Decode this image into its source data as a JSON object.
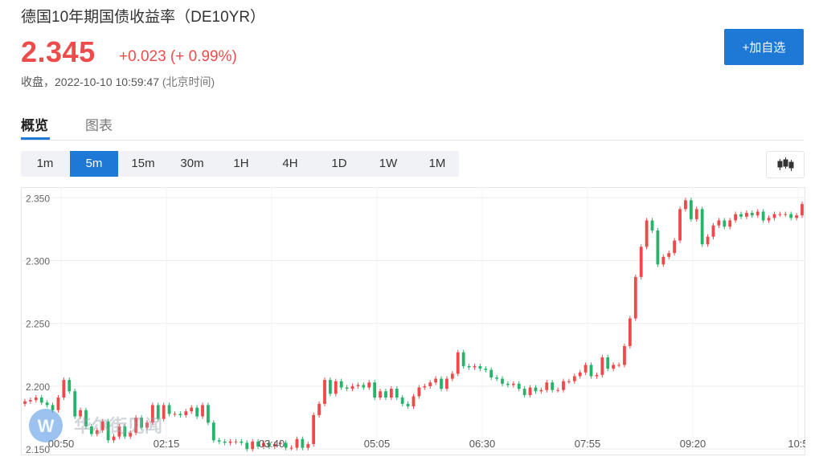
{
  "header": {
    "title": "德国10年期国债收益率（DE10YR）",
    "price": "2.345",
    "change": "+0.023 (+ 0.99%)",
    "status_label": "收盘，",
    "timestamp": "2022-10-10 10:59:47",
    "timezone": "(北京时间)",
    "add_button": "+加自选"
  },
  "tabs": [
    {
      "label": "概览",
      "active": true
    },
    {
      "label": "图表",
      "active": false
    }
  ],
  "intervals": [
    {
      "label": "1m",
      "active": false
    },
    {
      "label": "5m",
      "active": true
    },
    {
      "label": "15m",
      "active": false
    },
    {
      "label": "30m",
      "active": false
    },
    {
      "label": "1H",
      "active": false
    },
    {
      "label": "4H",
      "active": false
    },
    {
      "label": "1D",
      "active": false
    },
    {
      "label": "1W",
      "active": false
    },
    {
      "label": "1M",
      "active": false
    }
  ],
  "chart_type_icon": "candlestick-icon",
  "watermark": {
    "icon": "wallstreetcn-logo",
    "text": "华尔街见闻"
  },
  "colors": {
    "up": "#ef4a4a",
    "down": "#26b36a",
    "accent": "#1e78d6",
    "price": "#ee4b4b"
  },
  "chart_data": {
    "type": "candlestick",
    "interval": "5m",
    "y_ticks": [
      "2.350",
      "2.300",
      "2.250",
      "2.200",
      "2.150"
    ],
    "ylim": [
      2.145,
      2.3585
    ],
    "x_ticks": [
      "00:50",
      "02:15",
      "03:40",
      "05:05",
      "06:30",
      "07:55",
      "09:20",
      "10:5"
    ],
    "grid": true,
    "closes": [
      2.188,
      2.189,
      2.191,
      2.187,
      2.185,
      2.181,
      2.191,
      2.205,
      2.196,
      2.176,
      2.181,
      2.168,
      2.162,
      2.165,
      2.172,
      2.157,
      2.16,
      2.168,
      2.16,
      2.163,
      2.175,
      2.167,
      2.171,
      2.185,
      2.174,
      2.185,
      2.178,
      2.178,
      2.177,
      2.18,
      2.183,
      2.176,
      2.185,
      2.171,
      2.157,
      2.156,
      2.155,
      2.156,
      2.156,
      2.155,
      2.15,
      2.156,
      2.152,
      2.155,
      2.152,
      2.154,
      2.155,
      2.151,
      2.151,
      2.158,
      2.151,
      2.154,
      2.177,
      2.186,
      2.205,
      2.194,
      2.204,
      2.199,
      2.198,
      2.2,
      2.201,
      2.199,
      2.203,
      2.191,
      2.196,
      2.191,
      2.198,
      2.191,
      2.186,
      2.184,
      2.192,
      2.199,
      2.2,
      2.203,
      2.206,
      2.198,
      2.206,
      2.21,
      2.227,
      2.216,
      2.215,
      2.216,
      2.214,
      2.213,
      2.207,
      2.206,
      2.202,
      2.201,
      2.202,
      2.198,
      2.193,
      2.199,
      2.196,
      2.197,
      2.203,
      2.197,
      2.197,
      2.204,
      2.204,
      2.208,
      2.211,
      2.217,
      2.208,
      2.209,
      2.223,
      2.214,
      2.217,
      2.217,
      2.232,
      2.254,
      2.287,
      2.311,
      2.332,
      2.324,
      2.297,
      2.303,
      2.306,
      2.316,
      2.341,
      2.348,
      2.333,
      2.341,
      2.313,
      2.319,
      2.328,
      2.332,
      2.327,
      2.332,
      2.337,
      2.335,
      2.338,
      2.336,
      2.339,
      2.332,
      2.334,
      2.337,
      2.337,
      2.337,
      2.334,
      2.336,
      2.345
    ]
  }
}
